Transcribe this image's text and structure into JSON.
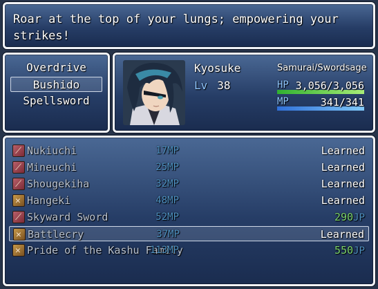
{
  "help": {
    "text": "Roar at the top of your lungs; empowering your strikes!"
  },
  "commands": [
    {
      "label": "Overdrive",
      "selected": false
    },
    {
      "label": "Bushido",
      "selected": true
    },
    {
      "label": "Spellsword",
      "selected": false
    }
  ],
  "actor": {
    "name": "Kyosuke",
    "level_label": "Lv",
    "level": "38",
    "class": "Samurai/Swordsage",
    "hp_label": "HP",
    "hp_text": "3,056/3,056",
    "hp_fraction": 1.0,
    "mp_label": "MP",
    "mp_text": "341/341",
    "mp_fraction": 1.0
  },
  "skills": [
    {
      "name": "Nukiuchi",
      "icon": "slash-icon",
      "icon_color": "red",
      "cost": "17MP",
      "status": "Learned",
      "jp": null
    },
    {
      "name": "Mineuchi",
      "icon": "slash-icon",
      "icon_color": "red",
      "cost": "25MP",
      "status": "Learned",
      "jp": null
    },
    {
      "name": "Shougekiha",
      "icon": "slash-icon",
      "icon_color": "red",
      "cost": "32MP",
      "status": "Learned",
      "jp": null
    },
    {
      "name": "Hangeki",
      "icon": "counter-icon",
      "icon_color": "gold",
      "cost": "48MP",
      "status": "Learned",
      "jp": null
    },
    {
      "name": "Skyward Sword",
      "icon": "slash-icon",
      "icon_color": "red",
      "cost": "52MP",
      "status": "",
      "jp": "290"
    },
    {
      "name": "Battlecry",
      "icon": "counter-icon",
      "icon_color": "gold",
      "cost": "37MP",
      "status": "Learned",
      "jp": null,
      "selected": true
    },
    {
      "name": "Pride of the Kashu Family",
      "icon": "counter-icon",
      "icon_color": "gold",
      "cost": "113MP",
      "status": "",
      "jp": "550"
    }
  ],
  "jp_unit": "JP"
}
